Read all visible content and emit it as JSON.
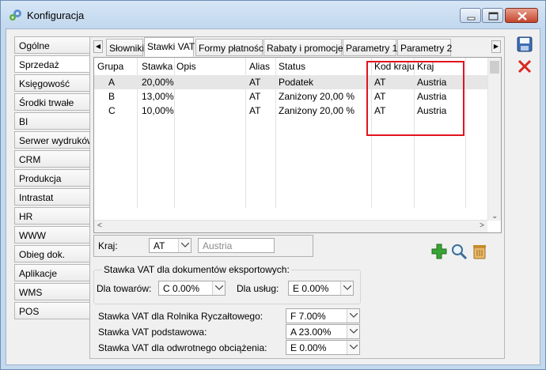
{
  "window": {
    "title": "Konfiguracja"
  },
  "nav": [
    "Ogólne",
    "Sprzedaż",
    "Księgowość",
    "Środki trwałe",
    "BI",
    "Serwer wydruków",
    "CRM",
    "Produkcja",
    "Intrastat",
    "HR",
    "WWW",
    "Obieg dok.",
    "Aplikacje",
    "WMS",
    "POS"
  ],
  "nav_active": "Sprzedaż",
  "tabs": [
    "Słowniki",
    "Stawki VAT",
    "Formy płatności",
    "Rabaty i promocje",
    "Parametry 1",
    "Parametry 2"
  ],
  "tab_active": "Stawki VAT",
  "table": {
    "headers": [
      "Grupa",
      "Stawka",
      "Opis",
      "Alias",
      "Status",
      "Kod kraju",
      "Kraj"
    ],
    "rows": [
      [
        "A",
        "20,00%",
        "",
        "AT",
        "Podatek",
        "AT",
        "Austria"
      ],
      [
        "B",
        "13,00%",
        "",
        "AT",
        "Zaniżony 20,00 %",
        "AT",
        "Austria"
      ],
      [
        "C",
        "10,00%",
        "",
        "AT",
        "Zaniżony 20,00 %",
        "AT",
        "Austria"
      ]
    ]
  },
  "filter": {
    "label": "Kraj:",
    "code": "AT",
    "name": "Austria"
  },
  "export": {
    "title": "Stawka VAT dla dokumentów eksportowych:",
    "goods_label": "Dla towarów:",
    "goods_value": "C 0.00%",
    "services_label": "Dla usług:",
    "services_value": "E 0.00%"
  },
  "vat_settings": [
    {
      "label": "Stawka VAT dla Rolnika Ryczałtowego:",
      "value": "F 7.00%"
    },
    {
      "label": "Stawka VAT podstawowa:",
      "value": "A 23.00%"
    },
    {
      "label": "Stawka VAT dla odwrotnego obciążenia:",
      "value": "E 0.00%"
    }
  ],
  "colors": {
    "highlight": "#e0141e",
    "add": "#3aa336",
    "delete": "#c98a2a"
  },
  "icons": [
    "save-icon",
    "cancel-icon",
    "add-icon",
    "search-icon",
    "trash-icon",
    "gear-icon"
  ]
}
